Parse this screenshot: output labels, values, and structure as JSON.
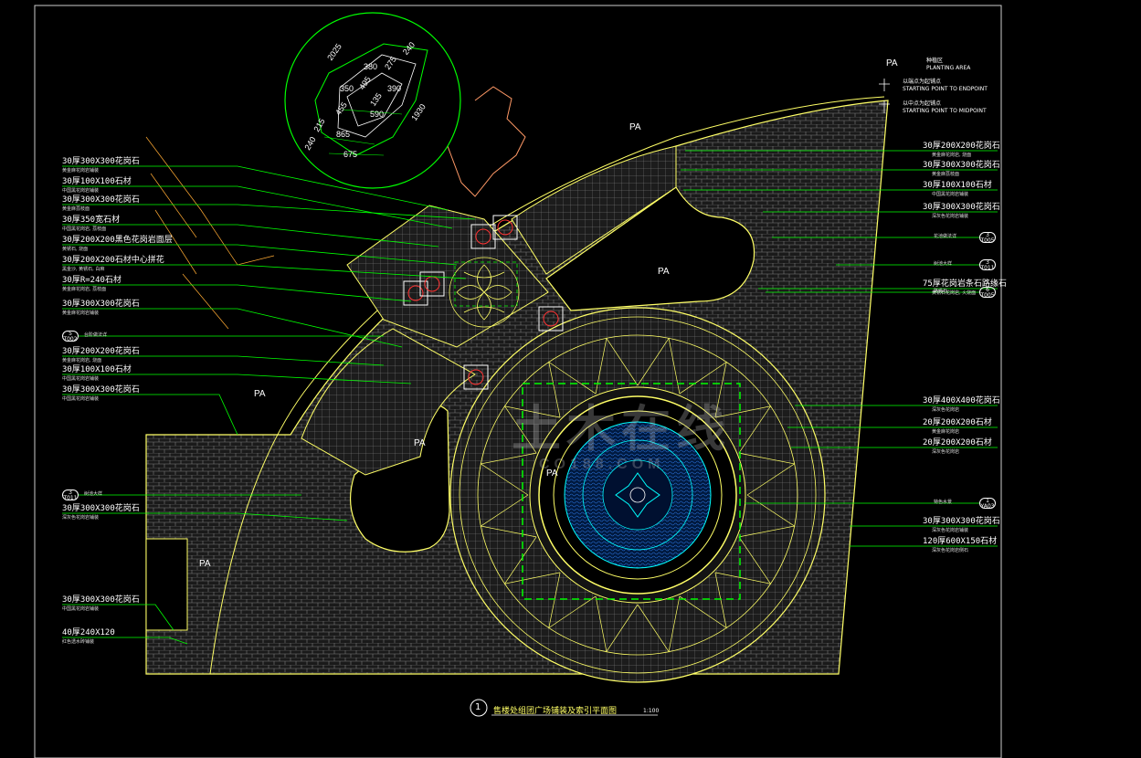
{
  "drawing": {
    "title": "售楼处组团广场铺装及索引平面图",
    "title_number": "1",
    "scale": "1:100"
  },
  "colors": {
    "background": "#000000",
    "line_green": "#00ff00",
    "line_yellow": "#ffff66",
    "line_cyan": "#00ffff",
    "line_red": "#ff3333",
    "text": "#ffffff"
  },
  "zone_labels": [
    "PA",
    "PA",
    "PA",
    "PA",
    "PA",
    "PA",
    "PA"
  ],
  "legend": {
    "pa_code": "PA",
    "pa_cn": "种植区",
    "pa_en": "PLANTING AREA",
    "start_cn": "以端点为起铺点",
    "start_en": "STARTING POINT TO ENDPOINT",
    "mid_cn": "以中点为起铺点",
    "mid_en": "STARTING POINT TO MIDPOINT"
  },
  "detail_dims": [
    "2025",
    "240",
    "380",
    "275",
    "350",
    "495",
    "390",
    "455",
    "135",
    "590",
    "215",
    "865",
    "240",
    "675",
    "1930"
  ],
  "left_notes": [
    {
      "main": "30厚300X300花岗石",
      "sub": "黄金麻花岗岩铺装"
    },
    {
      "main": "30厚100X100石材",
      "sub": "中国黑花岗岩铺装"
    },
    {
      "main": "30厚300X300花岗石",
      "sub": "黄金麻荔枝面"
    },
    {
      "main": "30厚350宽石材",
      "sub": "中国黑花岗岩, 荔枝面"
    },
    {
      "main": "30厚200X200黑色花岗岩面层",
      "sub": "黄锈石, 烧面"
    },
    {
      "main": "30厚200X200石材中心拼花",
      "sub": "黑金沙, 黄锈石, 白麻"
    },
    {
      "main": "30厚R=240石材",
      "sub": "黄金麻花岗岩, 荔枝面"
    },
    {
      "main": "30厚300X300花岗石",
      "sub": "黄金麻花岗岩铺装"
    },
    {
      "main": "30厚200X200花岗石",
      "sub": "黄金麻花岗岩, 烧面"
    },
    {
      "main": "30厚100X100石材",
      "sub": "中国黑花岗岩铺装"
    },
    {
      "main": "30厚300X300花岗石",
      "sub": "中国黑花岗岩铺装"
    },
    {
      "main": "30厚300X300花岗石",
      "sub": "深灰色花岗岩铺装"
    },
    {
      "main": "30厚300X300花岗石",
      "sub": "中国黑花岗岩铺装"
    },
    {
      "main": "40厚240X120",
      "sub": "红色透水砖铺装"
    }
  ],
  "left_bubbles": [
    {
      "top": "5",
      "bottom": "T002",
      "text": "台阶做法详"
    },
    {
      "top": "3",
      "bottom": "T011",
      "text": "树池大样"
    }
  ],
  "right_notes": [
    {
      "main": "30厚200X200花岗石",
      "sub": "黄金麻花岗岩, 烧面"
    },
    {
      "main": "30厚300X300花岗石",
      "sub": "黄金麻荔枝面"
    },
    {
      "main": "30厚100X100石材",
      "sub": "中国黑花岗岩铺装"
    },
    {
      "main": "30厚300X300花岗石",
      "sub": "深灰色花岗岩铺装"
    },
    {
      "main": "75厚花岗岩条石路缘石",
      "sub": "黄锈石花岗岩, 火烧面"
    },
    {
      "main": "30厚400X400花岗石",
      "sub": "深灰色花岗岩"
    },
    {
      "main": "20厚200X200石材",
      "sub": "黄金麻花岗岩"
    },
    {
      "main": "20厚200X200石材",
      "sub": "深灰色花岗岩"
    },
    {
      "main": "30厚300X300花岗石",
      "sub": "深灰色花岗岩铺装"
    },
    {
      "main": "120厚600X150石材",
      "sub": "深灰色花岗岩侧石"
    }
  ],
  "right_bubbles": [
    {
      "top": "3",
      "bottom": "T005",
      "text": "花池做法详"
    },
    {
      "top": "3",
      "bottom": "T011",
      "text": "树池大样"
    },
    {
      "top": "6",
      "bottom": "T005",
      "text": "路缘石"
    },
    {
      "top": "1",
      "bottom": "YA03",
      "text": "特色水景"
    }
  ],
  "watermark": {
    "main": "土木在线",
    "sub": "CO188.COM"
  }
}
